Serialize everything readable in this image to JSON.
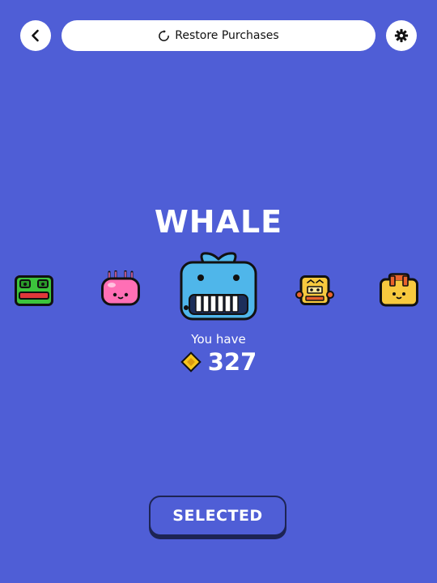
{
  "header": {
    "restore_label": "Restore Purchases",
    "back_icon": "back-chevron-icon",
    "settings_icon": "gear-icon",
    "restore_icon": "refresh-icon"
  },
  "character": {
    "name": "WHALE"
  },
  "carousel": {
    "items": [
      "frog",
      "jellyfish",
      "whale",
      "robot",
      "backpack"
    ],
    "selected_index": 2
  },
  "wallet": {
    "label": "You have",
    "amount": "327",
    "currency_icon": "diamond-coin-icon"
  },
  "action": {
    "label": "SELECTED"
  },
  "colors": {
    "background": "#4f5ed6",
    "coin": "#f5c51d",
    "button_border": "#1d2454"
  }
}
